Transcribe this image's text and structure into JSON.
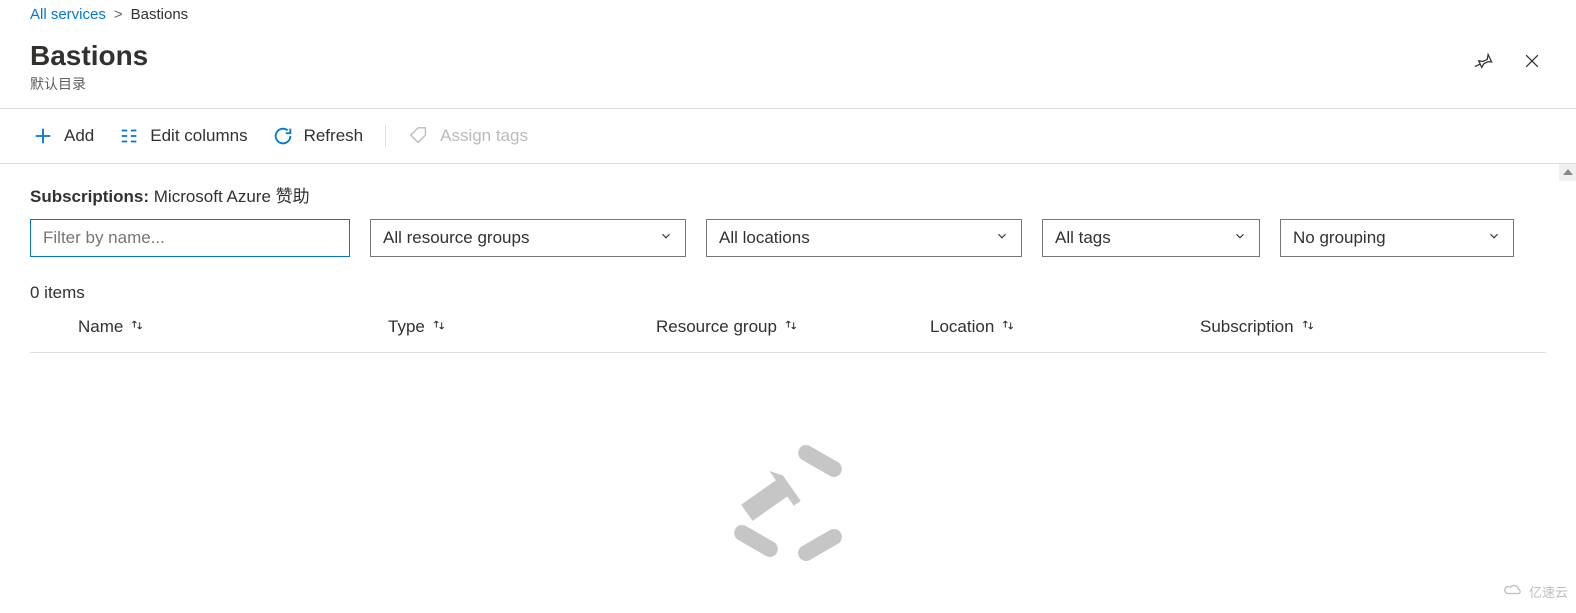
{
  "breadcrumb": {
    "root": "All services",
    "current": "Bastions"
  },
  "header": {
    "title": "Bastions",
    "subtitle": "默认目录"
  },
  "toolbar": {
    "add": "Add",
    "edit_columns": "Edit columns",
    "refresh": "Refresh",
    "assign_tags": "Assign tags"
  },
  "filters": {
    "subscriptions_label": "Subscriptions:",
    "subscriptions_value": "Microsoft Azure 赞助",
    "name_placeholder": "Filter by name...",
    "resource_groups": "All resource groups",
    "locations": "All locations",
    "tags": "All tags",
    "grouping": "No grouping"
  },
  "results": {
    "count_text": "0 items"
  },
  "columns": {
    "name": "Name",
    "type": "Type",
    "resource_group": "Resource group",
    "location": "Location",
    "subscription": "Subscription"
  },
  "watermark": "亿速云"
}
